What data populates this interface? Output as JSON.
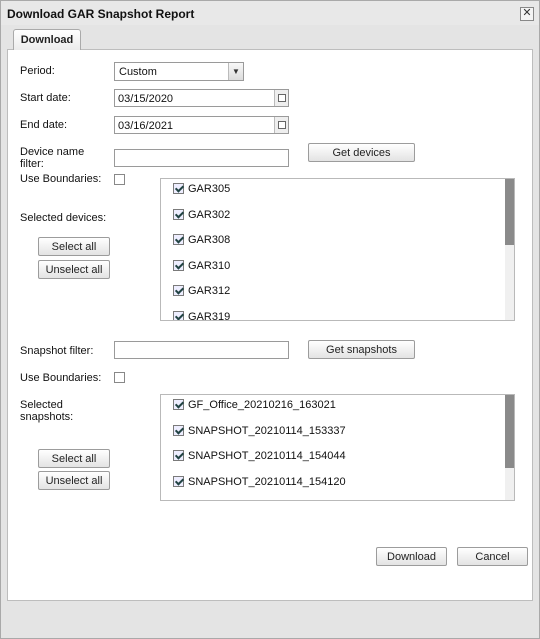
{
  "dialog": {
    "title": "Download GAR Snapshot Report",
    "close_glyph": "✕"
  },
  "tabs": [
    {
      "label": "Download"
    }
  ],
  "form": {
    "period_label": "Period:",
    "period_value": "Custom",
    "start_label": "Start date:",
    "start_value": "03/15/2020",
    "end_label": "End date:",
    "end_value": "03/16/2021",
    "device_filter_label_1": "Device name",
    "device_filter_label_2": "filter:",
    "device_filter_value": "",
    "get_devices": "Get devices",
    "use_boundaries_1": "Use Boundaries:",
    "selected_devices_label": "Selected devices:",
    "select_all_1": "Select all",
    "unselect_all_1": "Unselect all",
    "devices": [
      "GAR305",
      "GAR302",
      "GAR308",
      "GAR310",
      "GAR312",
      "GAR319"
    ],
    "snapshot_filter_label": "Snapshot filter:",
    "snapshot_filter_value": "",
    "get_snapshots": "Get snapshots",
    "use_boundaries_2": "Use Boundaries:",
    "selected_snapshots_label_1": "Selected",
    "selected_snapshots_label_2": "snapshots:",
    "select_all_2": "Select all",
    "unselect_all_2": "Unselect all",
    "snapshots": [
      "GF_Office_20210216_163021",
      "SNAPSHOT_20210114_153337",
      "SNAPSHOT_20210114_154044",
      "SNAPSHOT_20210114_154120"
    ]
  },
  "actions": {
    "download": "Download",
    "cancel": "Cancel"
  }
}
